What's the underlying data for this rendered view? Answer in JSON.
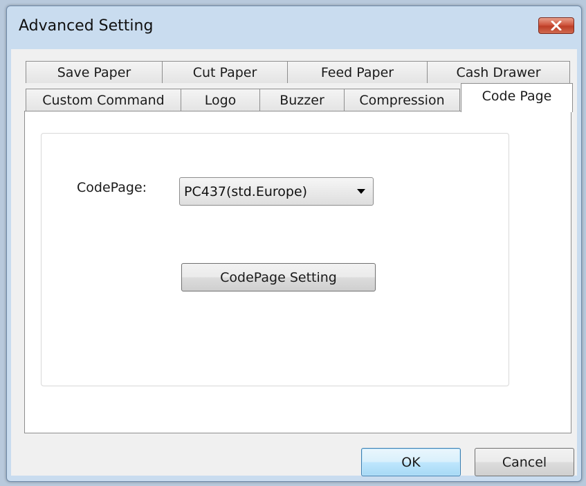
{
  "window": {
    "title": "Advanced Setting"
  },
  "tabs": {
    "row1": [
      {
        "label": "Save Paper"
      },
      {
        "label": "Cut Paper"
      },
      {
        "label": "Feed Paper"
      },
      {
        "label": "Cash Drawer"
      }
    ],
    "row2": [
      {
        "label": "Custom Command"
      },
      {
        "label": "Logo"
      },
      {
        "label": "Buzzer"
      },
      {
        "label": "Compression"
      },
      {
        "label": "Code Page"
      }
    ],
    "active": "Code Page"
  },
  "codepage_panel": {
    "label": "CodePage:",
    "selected_value": "PC437(std.Europe)",
    "setting_button": "CodePage Setting"
  },
  "buttons": {
    "ok": "OK",
    "cancel": "Cancel"
  },
  "colors": {
    "close_button": "#c9462e",
    "default_button_border": "#3c7fb1",
    "window_frame": "#c9dcef"
  }
}
